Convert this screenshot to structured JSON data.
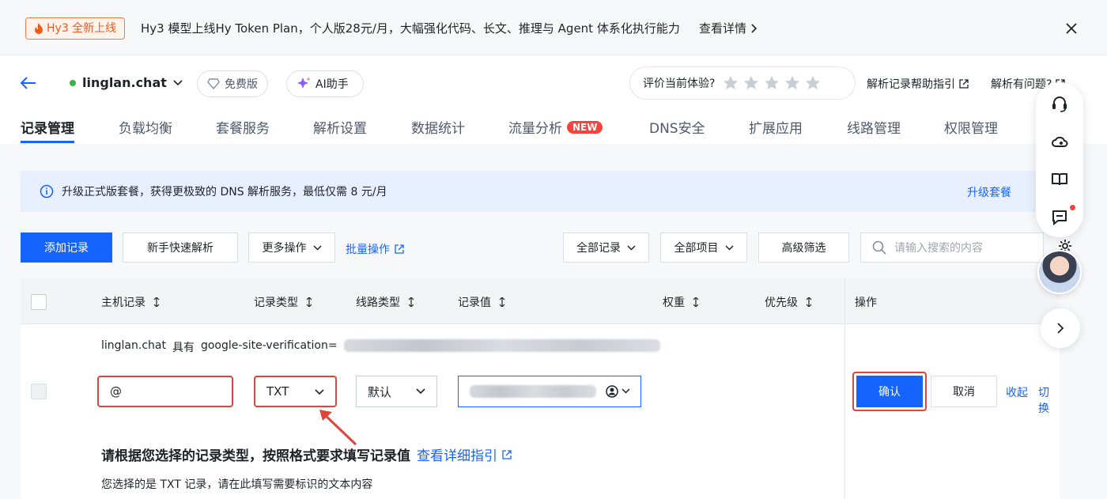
{
  "banner": {
    "badge": "Hy3 全新上线",
    "message": "Hy3 模型上线Hy Token Plan，个人版28元/月，大幅强化代码、长文、推理与 Agent 体系化执行能力",
    "detail": "查看详情"
  },
  "header": {
    "domain": "linglan.chat",
    "free_label": "免费版",
    "ai_label": "AI助手",
    "rate_label": "评价当前体验?",
    "help_link": "解析记录帮助指引",
    "problem_link": "解析有问题?"
  },
  "tabs": [
    {
      "label": "记录管理"
    },
    {
      "label": "负载均衡"
    },
    {
      "label": "套餐服务"
    },
    {
      "label": "解析设置"
    },
    {
      "label": "数据统计"
    },
    {
      "label": "流量分析",
      "badge": "NEW"
    },
    {
      "label": "DNS安全"
    },
    {
      "label": "扩展应用"
    },
    {
      "label": "线路管理"
    },
    {
      "label": "权限管理"
    }
  ],
  "notice": {
    "text": "升级正式版套餐，获得更极致的 DNS 解析服务，最低仅需 8 元/月",
    "upgrade": "升级套餐"
  },
  "toolbar": {
    "add": "添加记录",
    "quick": "新手快速解析",
    "more": "更多操作",
    "batch": "批量操作",
    "all_records": "全部记录",
    "all_projects": "全部项目",
    "advanced": "高级筛选",
    "search_placeholder": "请输入搜索的内容"
  },
  "table": {
    "columns": {
      "host": "主机记录",
      "type": "记录类型",
      "line": "线路类型",
      "value": "记录值",
      "weight": "权重",
      "priority": "优先级",
      "ops": "操作"
    },
    "desc_domain": "linglan.chat",
    "desc_has": "具有",
    "desc_value": "google-site-verification=",
    "row": {
      "host": "@",
      "type": "TXT",
      "line": "默认",
      "confirm": "确认",
      "cancel": "取消",
      "collapse": "收起",
      "switch": "切换"
    },
    "guide_title": "请根据您选择的记录类型，按照格式要求填写记录值",
    "guide_link": "查看详细指引",
    "guide_text": "您选择的是 TXT 记录，请在此填写需要标识的文本内容"
  },
  "colors": {
    "primary": "#1664ff",
    "highlight": "#e0453a",
    "new_badge": "#f5443d"
  }
}
